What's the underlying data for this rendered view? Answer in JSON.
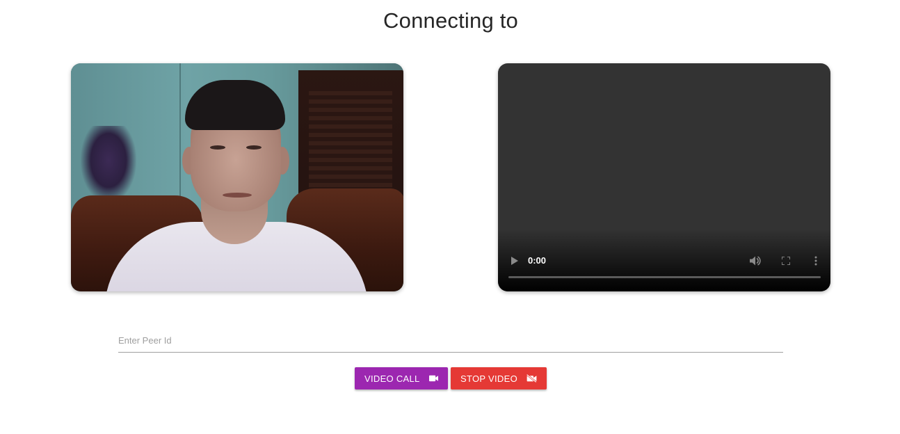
{
  "header": {
    "title": "Connecting to"
  },
  "local_video": {
    "description_icon": "camera-feed"
  },
  "remote_video": {
    "time": "0:00",
    "icons": [
      "play-icon",
      "volume-icon",
      "fullscreen-icon",
      "more-vert-icon"
    ]
  },
  "peer_input": {
    "placeholder": "Enter Peer Id",
    "value": ""
  },
  "buttons": {
    "video_call": {
      "label": "VIDEO CALL",
      "icon": "videocam-icon",
      "color": "#9c27b0"
    },
    "stop_video": {
      "label": "STOP VIDEO",
      "icon": "videocam-off-icon",
      "color": "#e53935"
    }
  }
}
